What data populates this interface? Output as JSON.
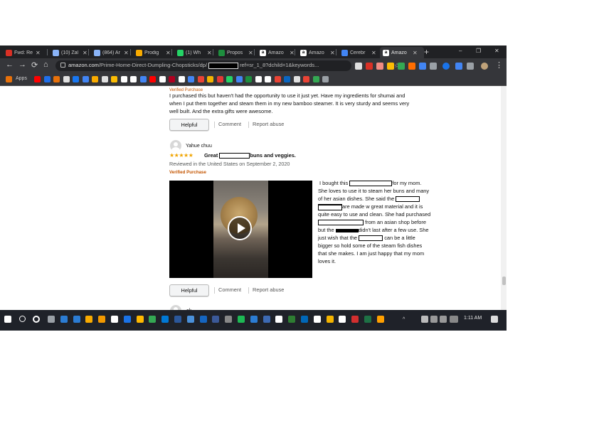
{
  "browser": {
    "tabs": [
      {
        "label": "Fwd: Re",
        "icon": "gmail-icon",
        "color": "#d93025"
      },
      {
        "label": "(10) Zal",
        "icon": "tab-icon",
        "color": "#8ab4f8"
      },
      {
        "label": "(864) Ar",
        "icon": "tab-icon",
        "color": "#8ab4f8"
      },
      {
        "label": "Prodig",
        "icon": "tab-icon",
        "color": "#f9ab00"
      },
      {
        "label": "(1) Wh",
        "icon": "whatsapp-icon",
        "color": "#25d366"
      },
      {
        "label": "Propos",
        "icon": "tab-icon",
        "color": "#1e8e3e"
      },
      {
        "label": "Amazo",
        "icon": "amazon-icon",
        "color": "#ffffff"
      },
      {
        "label": "Amazo",
        "icon": "amazon-icon",
        "color": "#ffffff"
      },
      {
        "label": "Cerebr",
        "icon": "tab-icon",
        "color": "#4285f4"
      },
      {
        "label": "Amazo",
        "icon": "amazon-icon",
        "color": "#ffffff"
      }
    ],
    "active_tab_index": 9,
    "new_tab_label": "+",
    "url_host": "amazon.com",
    "url_path_start": "/Prime-Home-Direct-Dumpling-Chopsticks/dp/",
    "url_path_end": "ref=sr_1_8?dchild=1&keywords...",
    "bookmarks_apps_label": "Apps",
    "window_controls": {
      "minimize": "–",
      "maximize": "❐",
      "close": "✕"
    }
  },
  "reviews": {
    "first_review_body": [
      "I purchased this but haven't had the opportunity to use it just yet. Have my ingredients for shumai and",
      "when I put them together and steam them in my new bamboo steamer. It is very sturdy and seems very",
      "well built. And the extra gifts were awesome."
    ],
    "helpful_label": "Helpful",
    "comment_label": "Comment",
    "report_label": "Report abuse",
    "second": {
      "reviewer": "Yahue chuu",
      "stars": 5,
      "title_start": "Great",
      "title_end": "buns and veggies.",
      "date": "Reviewed in the United States on September 2, 2020",
      "verified": "Verified Purchase",
      "body": {
        "l1a": "I bought this",
        "l1b": "for my mom.",
        "l2": "She loves to use it to steam her buns and many",
        "l3": "of her asian dishes. She said the",
        "l4b": "are made w great material and it is",
        "l5": "quite easy to use and clean. She had purchased",
        "l6b": "from an asian shop before",
        "l7a": "but the",
        "l7b": "didn't last after a few use. She",
        "l8a": "just wish that the",
        "l8b": "can be a little",
        "l9": "bigger so hold some of the steam fish dishes",
        "l10": "that she makes. I am just happy that my mom",
        "l11": "loves it."
      }
    },
    "third_reviewer": "ck"
  },
  "taskbar": {
    "time": "1:11 AM"
  },
  "colors": {
    "chrome_dark": "#202124",
    "chrome_toolbar": "#35363a",
    "verified_orange": "#c45500",
    "star_gold": "#f0a400",
    "taskbar": "#1f2229"
  }
}
